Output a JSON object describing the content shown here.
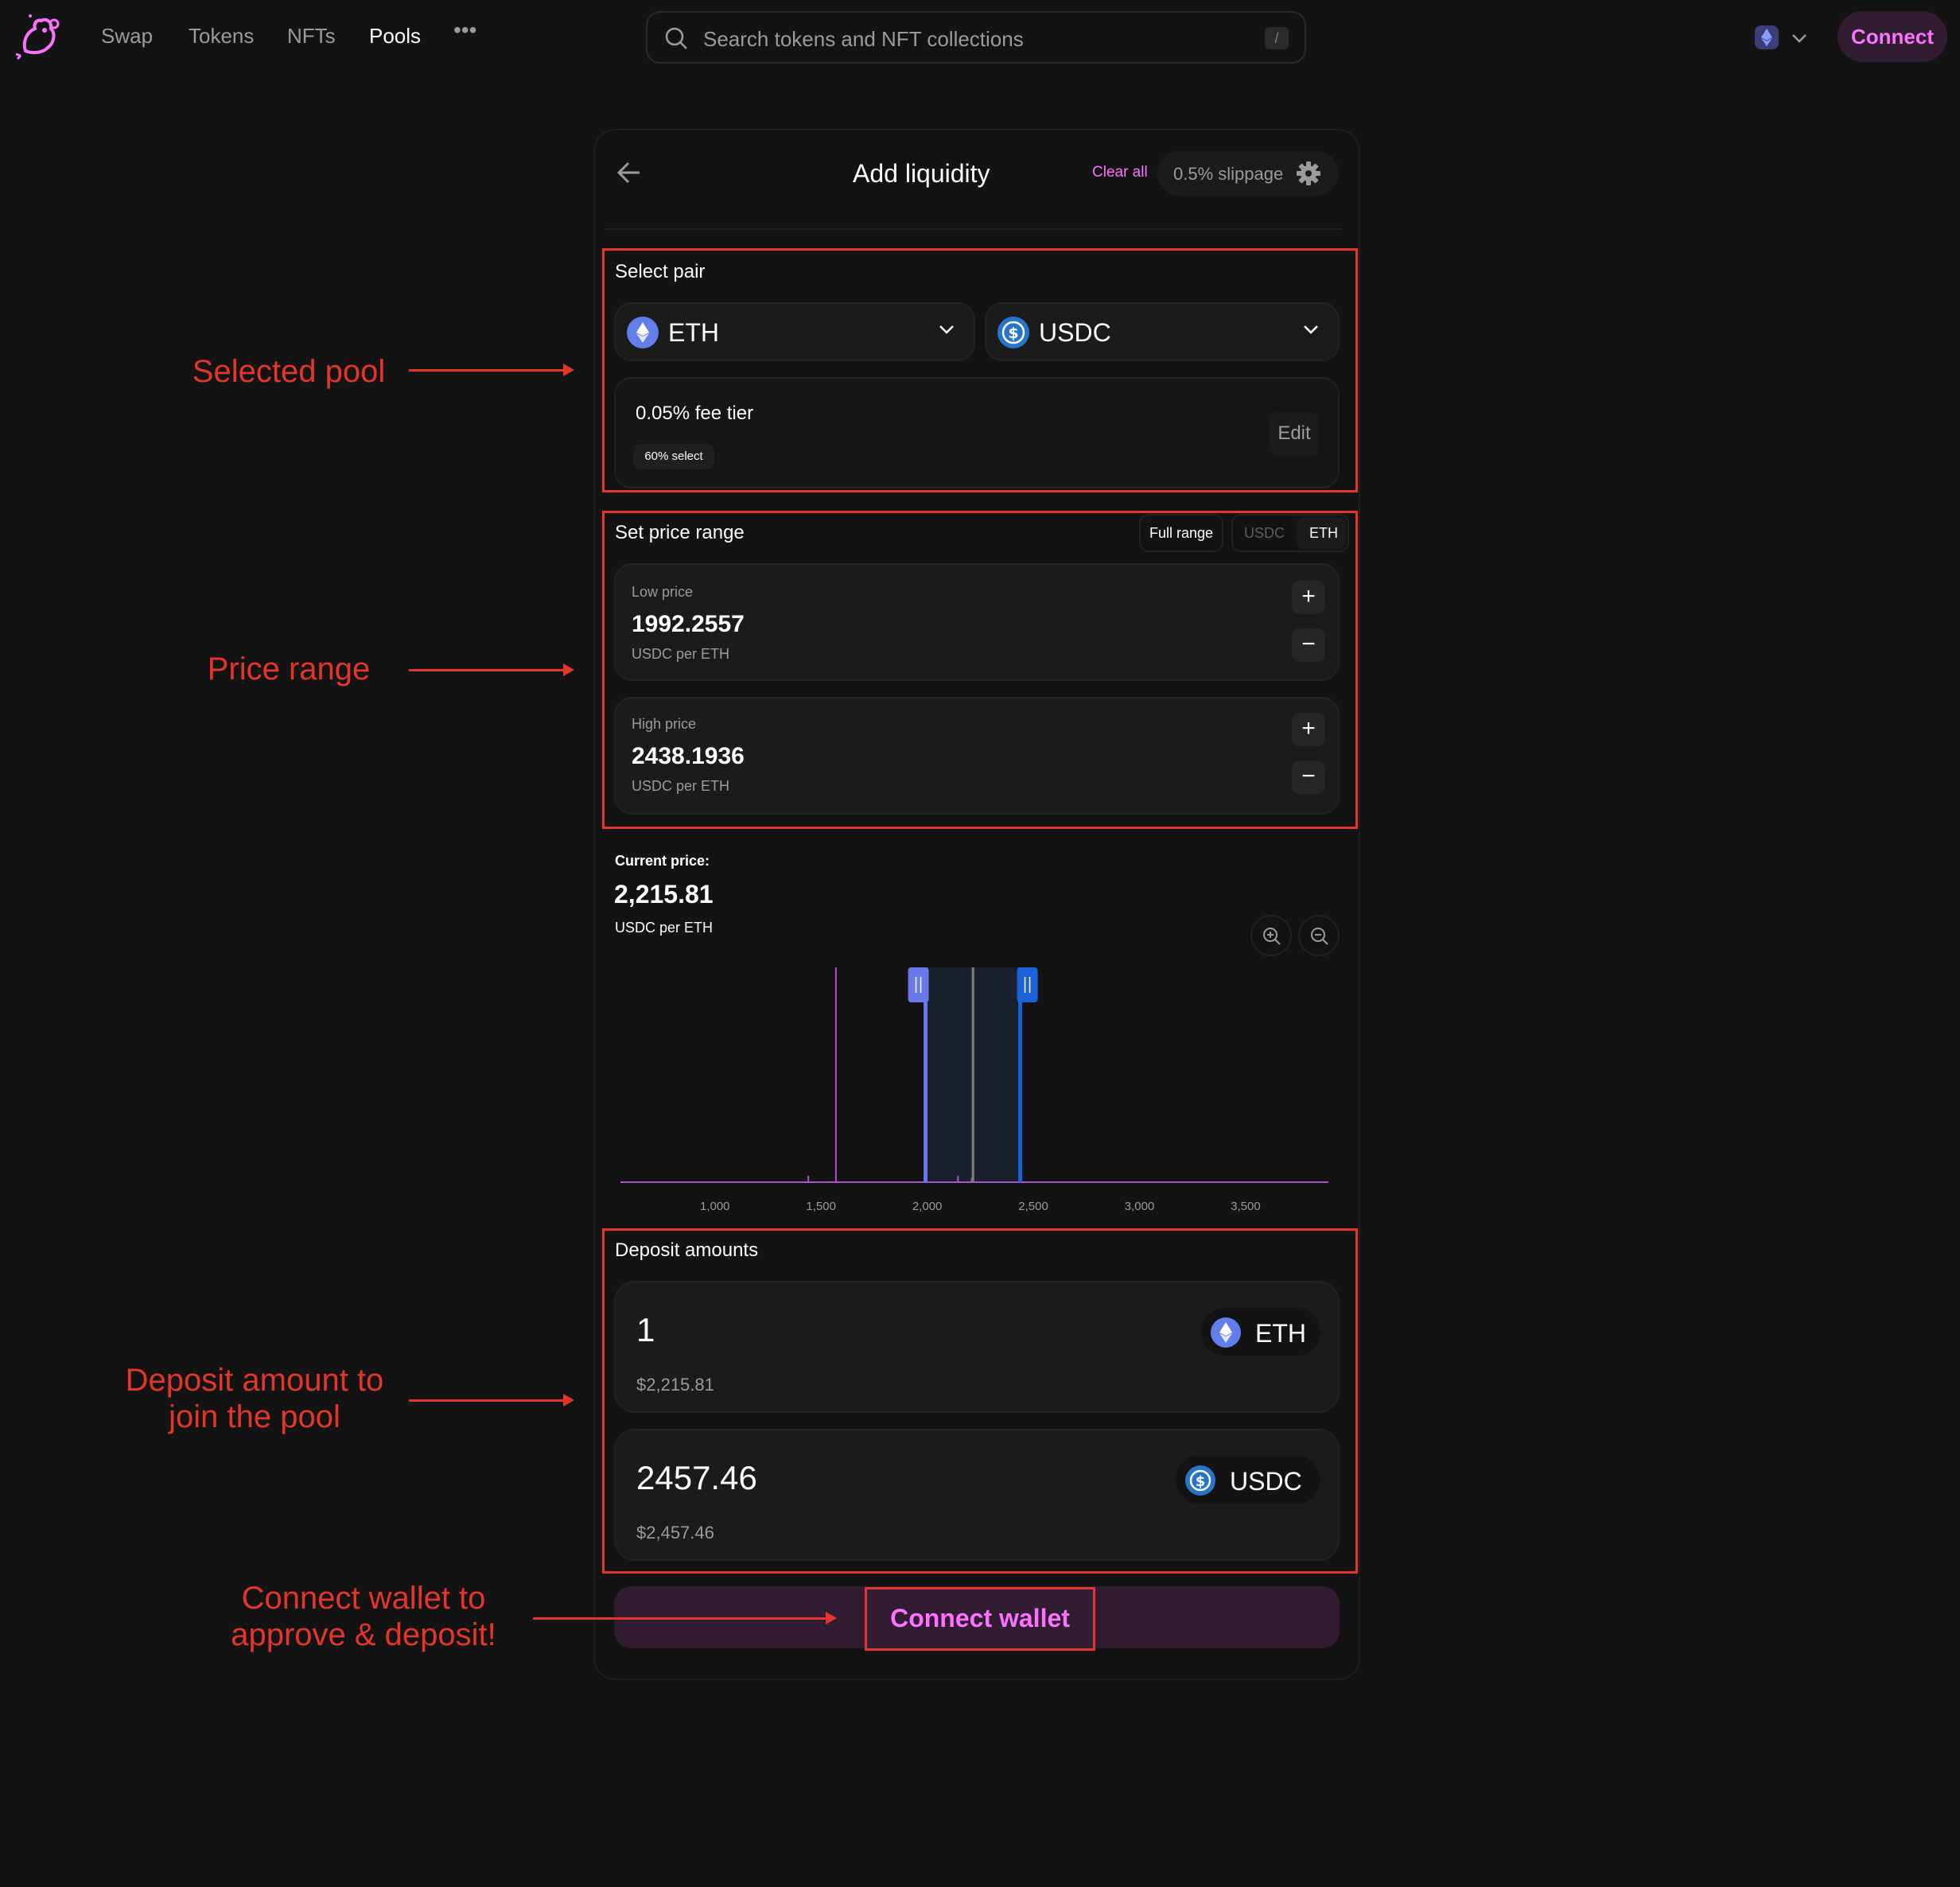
{
  "nav": {
    "links": [
      "Swap",
      "Tokens",
      "NFTs",
      "Pools"
    ],
    "active": "Pools",
    "more": "•••",
    "search_placeholder": "Search tokens and NFT collections",
    "search_shortcut": "/",
    "connect_label": "Connect"
  },
  "header": {
    "title": "Add liquidity",
    "clear_all": "Clear all",
    "slippage": "0.5% slippage"
  },
  "select_pair": {
    "label": "Select pair",
    "token_a": "ETH",
    "token_b": "USDC",
    "fee_tier": "0.05% fee tier",
    "fee_select": "60% select",
    "edit_label": "Edit"
  },
  "price_range": {
    "label": "Set price range",
    "full_range": "Full range",
    "toggle": [
      "USDC",
      "ETH"
    ],
    "toggle_active": "ETH",
    "low": {
      "label": "Low price",
      "value": "1992.2557",
      "unit": "USDC per ETH"
    },
    "high": {
      "label": "High price",
      "value": "2438.1936",
      "unit": "USDC per ETH"
    },
    "plus": "+",
    "minus": "−"
  },
  "current_price": {
    "label": "Current price:",
    "value": "2,215.81",
    "unit": "USDC per ETH"
  },
  "chart_data": {
    "type": "area",
    "x_ticks": [
      "1,000",
      "1,500",
      "2,000",
      "2,500",
      "3,000",
      "3,500"
    ],
    "x_tick_values": [
      1000,
      1500,
      2000,
      2500,
      3000,
      3500
    ],
    "xlim": [
      555,
      3890
    ],
    "range_low": 1992.2557,
    "range_high": 2438.1936,
    "current_price": 2215.81,
    "liquidity_spikes": [
      {
        "x": 1570,
        "y": 1.0
      },
      {
        "x": 1440,
        "y": 0.03
      },
      {
        "x": 2145,
        "y": 0.03
      },
      {
        "x": 2210,
        "y": 0.02
      }
    ],
    "colors": {
      "liquidity": "#a855c4",
      "low_handle": "#6a79e8",
      "high_handle": "#1b62d8",
      "current": "#7d7d7d"
    }
  },
  "deposit": {
    "label": "Deposit amounts",
    "eth": {
      "amount": "1",
      "usd": "$2,215.81",
      "token": "ETH"
    },
    "usdc": {
      "amount": "2457.46",
      "usd": "$2,457.46",
      "token": "USDC"
    }
  },
  "connect_wallet": "Connect wallet",
  "annotations": {
    "selected_pool": "Selected pool",
    "price_range": "Price range",
    "deposit": [
      "Deposit amount to",
      "join the pool"
    ],
    "connect": [
      "Connect wallet to",
      "approve & deposit!"
    ]
  },
  "colors": {
    "background": "#131313",
    "accent_pink": "#fc72ff",
    "annotation_red": "#e4352b",
    "eth_blue": "#627eea",
    "usdc_blue": "#2775ca"
  }
}
